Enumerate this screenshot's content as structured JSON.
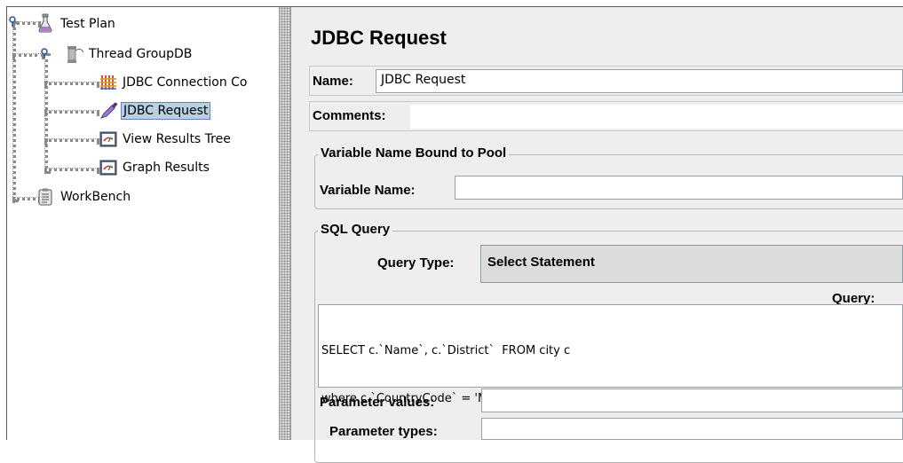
{
  "tree": {
    "nodes": [
      {
        "label": "Test Plan",
        "icon": "flask-icon"
      },
      {
        "label": "Thread GroupDB",
        "icon": "spool-icon"
      },
      {
        "label": "JDBC Connection Co",
        "icon": "jdbc-config-icon"
      },
      {
        "label": "JDBC Request",
        "icon": "dropper-icon"
      },
      {
        "label": "View Results Tree",
        "icon": "listener-icon"
      },
      {
        "label": "Graph Results",
        "icon": "listener-icon"
      },
      {
        "label": "WorkBench",
        "icon": "clipboard-icon"
      }
    ],
    "selected": "JDBC Request"
  },
  "panel": {
    "title": "JDBC Request",
    "name_label": "Name:",
    "name_value": "JDBC Request",
    "comments_label": "Comments:",
    "comments_value": "",
    "pool_group_title": "Variable Name Bound to Pool",
    "variable_name_label": "Variable Name:",
    "variable_name_value": "",
    "sql_group_title": "SQL Query",
    "query_type_label": "Query Type:",
    "query_type_value": "Select Statement",
    "query_label": "Query:",
    "query_line1": "SELECT c.`Name`, c.`District`  FROM city c",
    "query_line2": "where c.`CountryCode` = 'MYS'",
    "param_values_label": "Parameter values:",
    "param_values_value": "",
    "param_types_label": "Parameter types:",
    "param_types_value": ""
  },
  "colors": {
    "selection_bg": "#b8cfe5",
    "panel_bg": "#eeeeee",
    "splitter_bg": "#d6d6d6"
  }
}
